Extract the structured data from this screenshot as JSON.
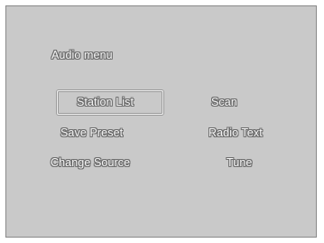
{
  "menu": {
    "title": "Audio menu",
    "items": {
      "station_list": "Station List",
      "scan": "Scan",
      "save_preset": "Save Preset",
      "radio_text": "Radio Text",
      "change_source": "Change Source",
      "tune": "Tune"
    },
    "selected": "station_list"
  },
  "colors": {
    "background": "#c9c9c9",
    "text": "#f5f5f5",
    "text_outline": "#6e6e6e",
    "frame_border": "#8a8a8a"
  }
}
